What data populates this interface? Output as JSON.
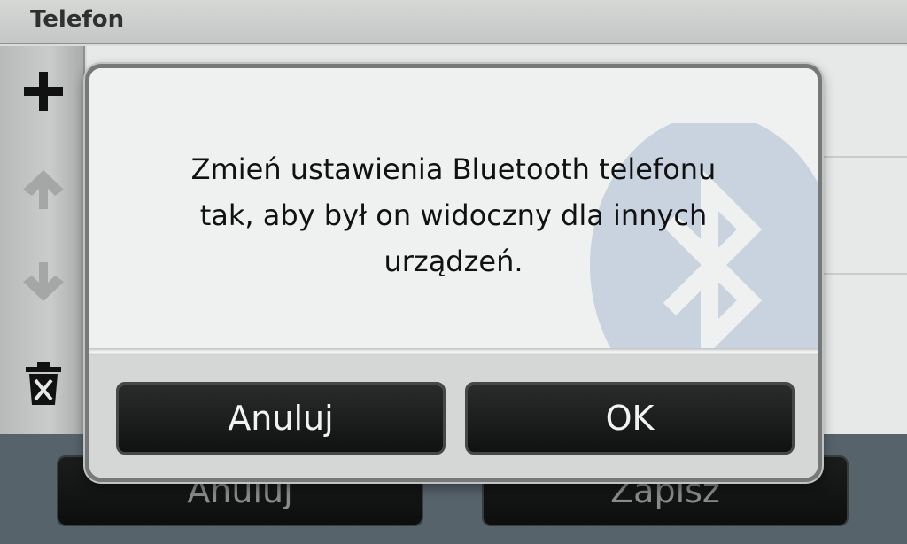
{
  "screen": {
    "title": "Telefon",
    "toolbar_icons": [
      "plus-icon",
      "arrow-up-icon",
      "arrow-down-icon",
      "trash-icon"
    ],
    "bottom_buttons": {
      "cancel_label": "Anuluj",
      "save_label": "Zapisz"
    }
  },
  "dialog": {
    "message_line1": "Zmień ustawienia Bluetooth telefonu",
    "message_line2": "tak, aby był on widoczny dla innych",
    "message_line3": "urządzeń.",
    "cancel_label": "Anuluj",
    "ok_label": "OK",
    "watermark_icon": "bluetooth-icon"
  },
  "colors": {
    "bottom_bar": "#56636b",
    "button_dark": "#141515",
    "watermark": "#c9d3df"
  }
}
